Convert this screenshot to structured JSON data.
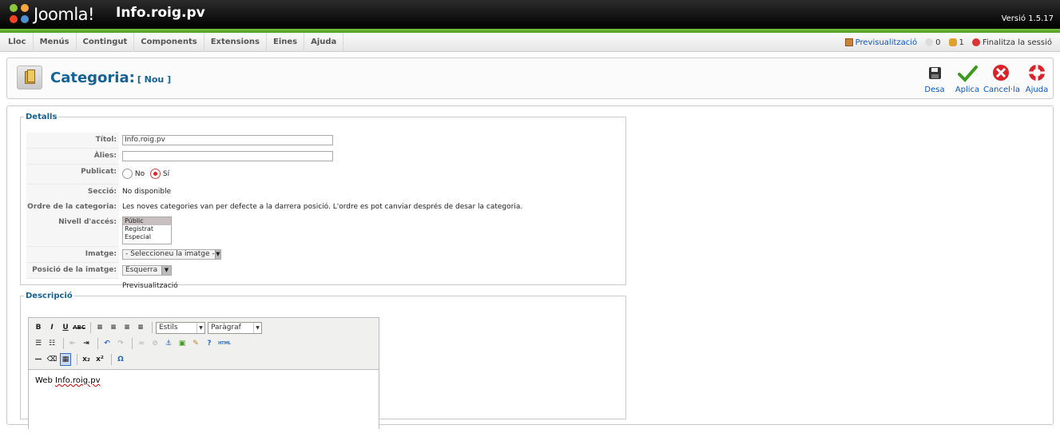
{
  "header": {
    "brand": "Joomla!",
    "site_name": "Info.roig.pv",
    "version": "Versió 1.5.17"
  },
  "menu": {
    "items": [
      "Lloc",
      "Menús",
      "Contingut",
      "Components",
      "Extensions",
      "Eines",
      "Ajuda"
    ]
  },
  "status": {
    "preview": "Previsualització",
    "messages": "0",
    "users": "1",
    "logout": "Finalitza la sessió"
  },
  "toolbar": {
    "title": "Categoria:",
    "subtitle": "[ Nou ]",
    "buttons": [
      "Desa",
      "Aplica",
      "Cancel·la",
      "Ajuda"
    ]
  },
  "details": {
    "legend": "Detalls",
    "title_label": "Títol:",
    "title_value": "Info.roig.pv",
    "alias_label": "Àlies:",
    "alias_value": "",
    "published_label": "Publicat:",
    "published_no": "No",
    "published_yes": "Sí",
    "section_label": "Secció:",
    "section_value": "No disponible",
    "order_label": "Ordre de la categoria:",
    "order_value": "Les noves categories van per defecte a la darrera posició. L'ordre es pot canviar després de desar la categoria.",
    "access_label": "Nivell d'accés:",
    "access_options": [
      "Públic",
      "Registrat",
      "Especial"
    ],
    "image_label": "Imatge:",
    "image_value": "- Seleccioneu la imatge -",
    "image_pos_label": "Posició de la imatge:",
    "image_pos_value": "Esquerra",
    "preview_label": "Previsualització"
  },
  "description": {
    "legend": "Descripció",
    "styles": "Estils",
    "format": "Paràgraf",
    "html_label": "HTML",
    "content_prefix": "Web ",
    "content_word": "Info.roig.pv"
  },
  "colors": {
    "accent": "#146295",
    "green": "#6db33f"
  }
}
